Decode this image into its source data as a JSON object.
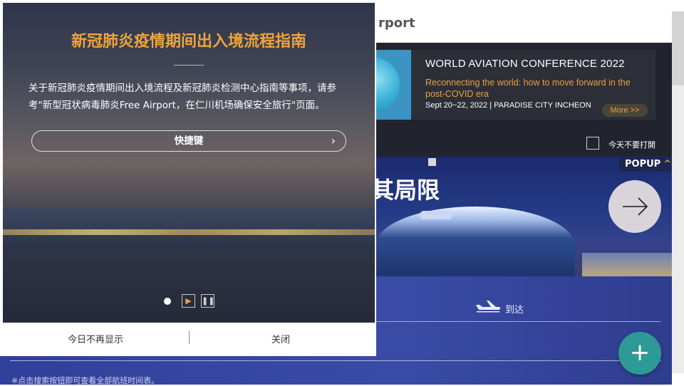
{
  "site": {
    "title_fragment": "rport"
  },
  "conference_popup": {
    "banner_title": "WORLD AVIATION CONFERENCE 2022",
    "banner_subtitle": "Reconnecting the world: how to move forward in the post-COVID era",
    "banner_date": "Sept 20~22, 2022 | PARADISE CITY INCHEON",
    "more_label": "More >>",
    "dont_open_today": "今天不要打開"
  },
  "hero": {
    "headline_fragment": "其局限",
    "popup_tag": "POPUP",
    "popup_tag_icon": "chevron-up-icon",
    "next_icon": "arrow-right-icon"
  },
  "search": {
    "arrival_tab": "到达",
    "arrival_icon": "plane-landing-icon",
    "notice": "※点击搜索按钮即可查看全部航班时间表。"
  },
  "fab": {
    "label": "+",
    "icon": "plus-icon"
  },
  "covid_popup": {
    "title": "新冠肺炎疫情期间出入境流程指南",
    "description": "关于新冠肺炎疫情期间出入境流程及新冠肺炎检测中心指南等事项，请参考\"新型冠状病毒肺炎Free Airport，在仁川机场确保安全旅行\"页面。",
    "shortcut_label": "快捷键",
    "shortcut_icon": "chevron-right-icon",
    "play_icon": "play-icon",
    "pause_icon": "pause-icon",
    "slide_dot_icon": "slide-indicator-dot",
    "footer": {
      "dont_show_today": "今日不再显示",
      "close": "关闭"
    }
  },
  "colors": {
    "accent_orange": "#f1a33a",
    "navy_panel": "#31409a",
    "fab_teal": "#2e9a96"
  }
}
